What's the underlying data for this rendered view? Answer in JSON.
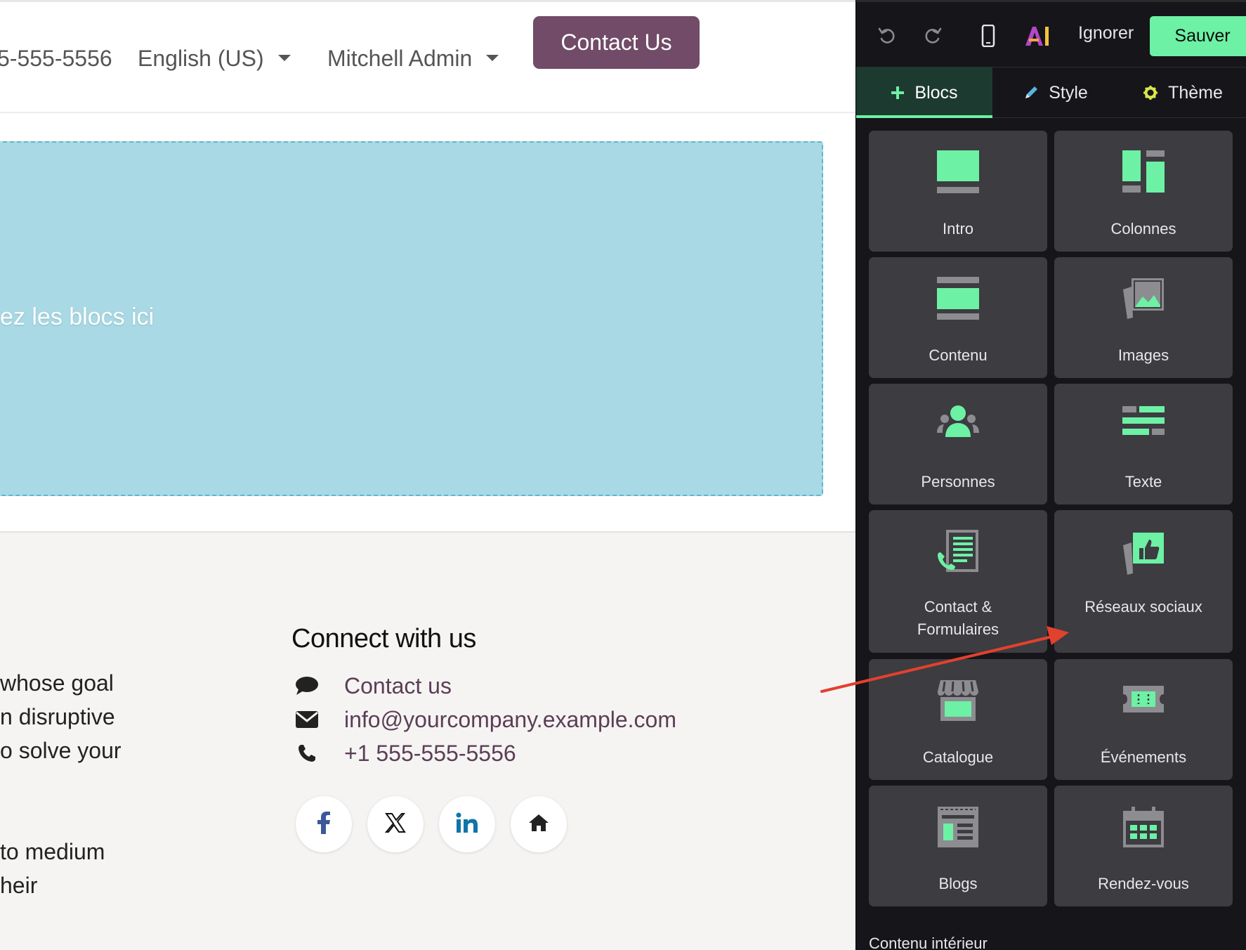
{
  "header": {
    "phone_partial": "5-555-5556",
    "language": "English (US)",
    "user": "Mitchell Admin",
    "contact_button": "Contact Us"
  },
  "dropzone": {
    "text": "ez les blocs ici"
  },
  "footer": {
    "about_lines": [
      " whose goal",
      "n disruptive",
      "o solve your",
      " to medium",
      "heir"
    ],
    "connect_title": "Connect with us",
    "contact_items": [
      {
        "icon": "comment-icon",
        "label": "Contact us"
      },
      {
        "icon": "envelope-icon",
        "label": "info@yourcompany.example.com"
      },
      {
        "icon": "phone-icon",
        "label": "+1 555-555-5556"
      }
    ],
    "social": [
      "facebook-icon",
      "x-twitter-icon",
      "linkedin-icon",
      "home-icon"
    ]
  },
  "editor": {
    "toolbar": {
      "undo_icon": "undo-icon",
      "redo_icon": "redo-icon",
      "mobile_icon": "mobile-preview-icon",
      "ai_label": "AI",
      "ignore": "Ignorer",
      "save": "Sauver"
    },
    "tabs": [
      {
        "label": "Blocs",
        "icon": "plus-icon",
        "active": true
      },
      {
        "label": "Style",
        "icon": "pencil-icon",
        "active": false
      },
      {
        "label": "Thème",
        "icon": "gear-icon",
        "active": false
      }
    ],
    "blocks": [
      {
        "label": "Intro",
        "icon": "intro-icon"
      },
      {
        "label": "Colonnes",
        "icon": "columns-icon"
      },
      {
        "label": "Contenu",
        "icon": "content-icon"
      },
      {
        "label": "Images",
        "icon": "images-icon"
      },
      {
        "label": "Personnes",
        "icon": "people-icon"
      },
      {
        "label": "Texte",
        "icon": "text-icon"
      },
      {
        "label_line1": "Contact &",
        "label_line2": "Formulaires",
        "icon": "contact-forms-icon"
      },
      {
        "label": "Réseaux sociaux",
        "icon": "social-media-icon"
      },
      {
        "label": "Catalogue",
        "icon": "catalog-icon"
      },
      {
        "label": "Événements",
        "icon": "events-icon"
      },
      {
        "label": "Blogs",
        "icon": "blogs-icon"
      },
      {
        "label": "Rendez-vous",
        "icon": "appointments-icon"
      }
    ],
    "section_label": "Contenu intérieur"
  },
  "colors": {
    "accent_green": "#6df1a4",
    "brand_purple": "#714b67",
    "link_purple": "#5b3e55",
    "dropzone_blue": "#a8d9e4",
    "panel_bg": "#16151a",
    "block_bg": "#3c3c41",
    "annotation_arrow": "#e2412e"
  }
}
